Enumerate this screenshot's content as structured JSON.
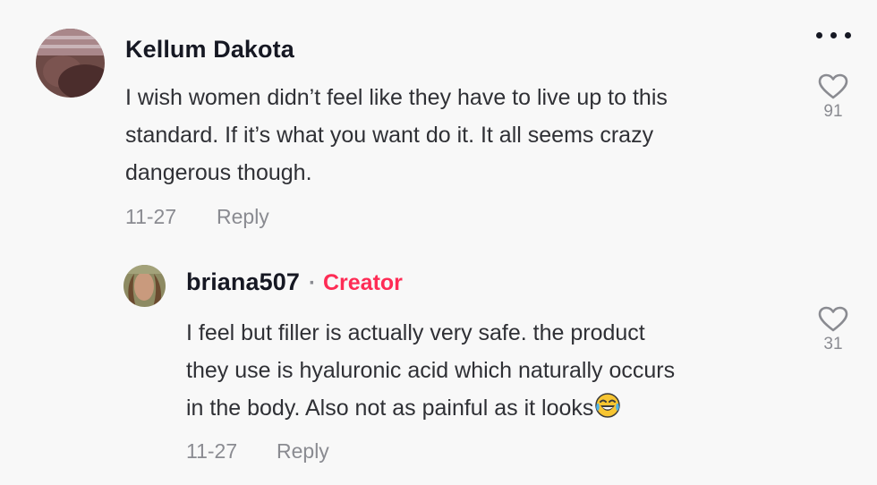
{
  "comment": {
    "username": "Kellum Dakota",
    "text": "I wish women didn’t feel like they have to live up to this\nstandard. If it’s what you want do it. It all seems crazy\ndangerous though.",
    "date": "11-27",
    "reply_label": "Reply",
    "like_count": "91"
  },
  "reply": {
    "username": "briana507",
    "separator": "·",
    "badge": "Creator",
    "text": "I feel but filler is actually very safe. the product\nthey use is hyaluronic acid which naturally occurs\nin the body. Also not as painful as it looks",
    "emoji_icon": "tears-of-joy-icon",
    "date": "11-27",
    "reply_label": "Reply",
    "like_count": "31"
  },
  "colors": {
    "creator_badge": "#fe2c55",
    "muted": "#8a8b91",
    "text": "#2f3035"
  },
  "icons": {
    "more": "more-horizontal-icon",
    "like": "heart-outline-icon"
  }
}
